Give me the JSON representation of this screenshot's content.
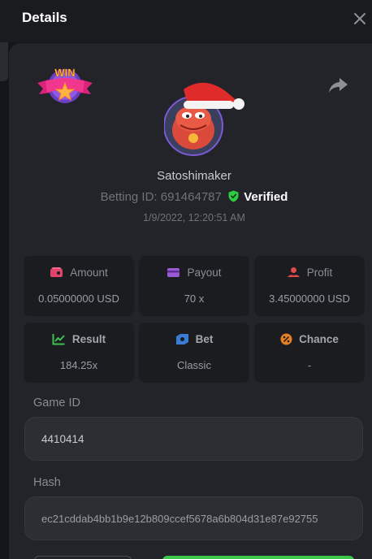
{
  "modal": {
    "title": "Details"
  },
  "player": {
    "username": "Satoshimaker",
    "betting_id_label": "Betting ID:",
    "betting_id": "691464787",
    "verified_label": "Verified",
    "datetime": "1/9/2022, 12:20:51 AM"
  },
  "badge": {
    "text": "WIN"
  },
  "stats": {
    "amount": {
      "label": "Amount",
      "value": "0.05000000 USD"
    },
    "payout": {
      "label": "Payout",
      "value": "70 x"
    },
    "profit": {
      "label": "Profit",
      "value": "3.45000000 USD"
    },
    "result": {
      "label": "Result",
      "value": "184.25x"
    },
    "bet": {
      "label": "Bet",
      "value": "Classic"
    },
    "chance": {
      "label": "Chance",
      "value": "-"
    }
  },
  "game_id": {
    "label": "Game ID",
    "value": "4410414"
  },
  "hash": {
    "label": "Hash",
    "value": "ec21cddab4bb1b9e12b809ccef5678a6b804d31e87e92755"
  },
  "colors": {
    "verified_green": "#2ecc40",
    "amount_icon": "#e0446a",
    "payout_icon": "#9b59d6",
    "profit_icon": "#e04a4a",
    "result_icon": "#3fbf4f",
    "bet_icon": "#3a7bd5",
    "chance_icon": "#e67e22"
  }
}
